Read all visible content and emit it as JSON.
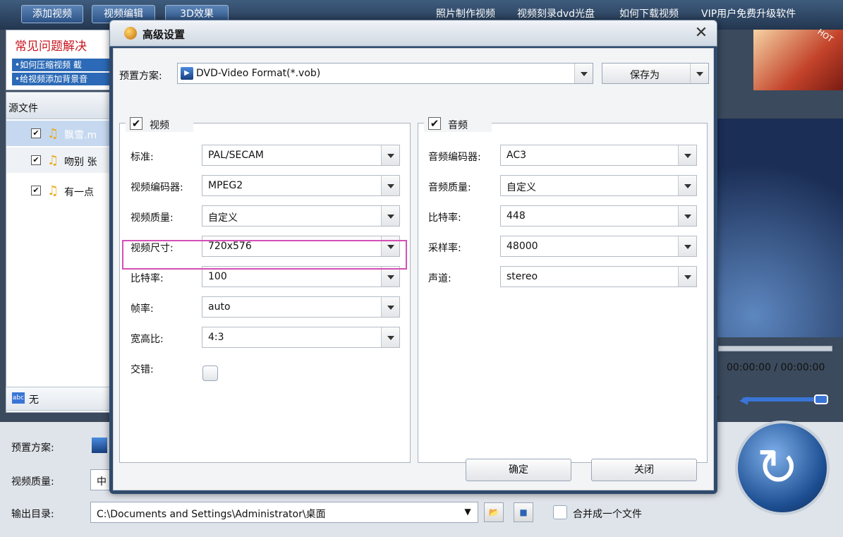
{
  "toolbar": {
    "add_video": "添加视频",
    "video_edit": "视频编辑",
    "effect_3d": "3D效果",
    "links": [
      "照片制作视频",
      "视频刻录dvd光盘",
      "如何下载视频",
      "VIP用户免费升级软件"
    ]
  },
  "faq": {
    "title": "常见问题解决",
    "items": [
      "•如何压缩视频 截",
      "•给视频添加背景音"
    ]
  },
  "ad": {
    "badge": "HOT"
  },
  "file_list": {
    "header": "源文件",
    "items": [
      {
        "name": "飘雪.m",
        "checked": true
      },
      {
        "name": "吻别 张",
        "checked": true
      },
      {
        "name": "有一点",
        "checked": true
      }
    ],
    "subtitle": "无"
  },
  "player": {
    "time": "00:00:00 / 00:00:00"
  },
  "bottom": {
    "preset_label": "预置方案:",
    "quality_label": "视频质量:",
    "quality_value": "中",
    "output_label": "输出目录:",
    "output_path": "C:\\Documents and Settings\\Administrator\\桌面",
    "merge_label": "合并成一个文件"
  },
  "dialog": {
    "title": "高级设置",
    "preset_label": "预置方案:",
    "preset_value": "DVD-Video Format(*.vob)",
    "save_as": "保存为",
    "video": {
      "title": "视频",
      "enabled": true,
      "fields": [
        {
          "label": "标准:",
          "value": "PAL/SECAM"
        },
        {
          "label": "视频编码器:",
          "value": "MPEG2"
        },
        {
          "label": "视频质量:",
          "value": "自定义"
        },
        {
          "label": "视频尺寸:",
          "value": "720x576"
        },
        {
          "label": "比特率:",
          "value": "100"
        },
        {
          "label": "帧率:",
          "value": "auto"
        },
        {
          "label": "宽高比:",
          "value": "4:3"
        }
      ],
      "interlace_label": "交错:"
    },
    "audio": {
      "title": "音频",
      "enabled": true,
      "fields": [
        {
          "label": "音频编码器:",
          "value": "AC3"
        },
        {
          "label": "音频质量:",
          "value": "自定义"
        },
        {
          "label": "比特率:",
          "value": "448"
        },
        {
          "label": "采样率:",
          "value": "48000"
        },
        {
          "label": "声道:",
          "value": "stereo"
        }
      ]
    },
    "ok": "确定",
    "close": "关闭"
  }
}
